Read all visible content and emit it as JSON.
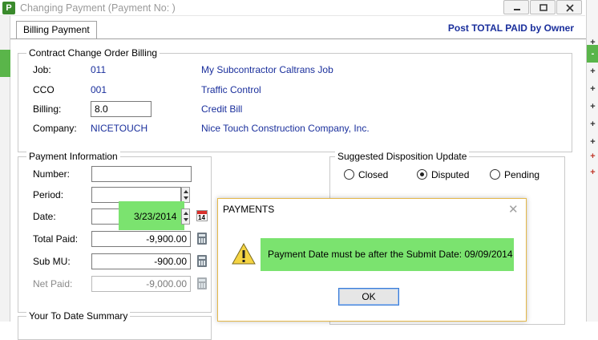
{
  "window": {
    "title": "Changing Payment (Payment No:          )",
    "app_icon_letter": "P"
  },
  "tabs": [
    {
      "label": "Billing Payment",
      "active": true
    }
  ],
  "header": {
    "post_total_label": "Post TOTAL PAID by Owner"
  },
  "cco_billing": {
    "legend": "Contract Change Order Billing",
    "job_label": "Job:",
    "job_code": "011",
    "job_name": "My Subcontractor Caltrans Job",
    "cco_label": "CCO",
    "cco_code": "001",
    "cco_name": "Traffic Control",
    "billing_label": "Billing:",
    "billing_value": "8.0",
    "billing_desc": "Credit Bill",
    "company_label": "Company:",
    "company_code": "NICETOUCH",
    "company_name": "Nice Touch Construction Company, Inc."
  },
  "payment_info": {
    "legend": "Payment Information",
    "number_label": "Number:",
    "number_value": "",
    "period_label": "Period:",
    "period_value": "",
    "date_label": "Date:",
    "date_value": "3/23/2014",
    "total_paid_label": "Total Paid:",
    "total_paid_value": "-9,900.00",
    "sub_mu_label": "Sub MU:",
    "sub_mu_value": "-900.00",
    "net_paid_label": "Net Paid:",
    "net_paid_value": "-9,000.00",
    "calendar_day": "14"
  },
  "disposition": {
    "legend": "Suggested Disposition Update",
    "options": [
      {
        "label": "Closed",
        "checked": false
      },
      {
        "label": "Disputed",
        "checked": true
      },
      {
        "label": "Pending",
        "checked": false
      }
    ]
  },
  "to_date": {
    "legend": "Your To Date Summary"
  },
  "right_strip": [
    "+",
    "-",
    "+",
    "+",
    "+",
    "+",
    "+",
    "+",
    "+"
  ],
  "dialog": {
    "title": "PAYMENTS",
    "message": "Payment Date must be after the Submit Date: 09/09/2014",
    "ok_label": "OK"
  },
  "colors": {
    "link_blue": "#1a2f9c",
    "highlight_green": "#7be36f",
    "dialog_border": "#e4b84a"
  }
}
